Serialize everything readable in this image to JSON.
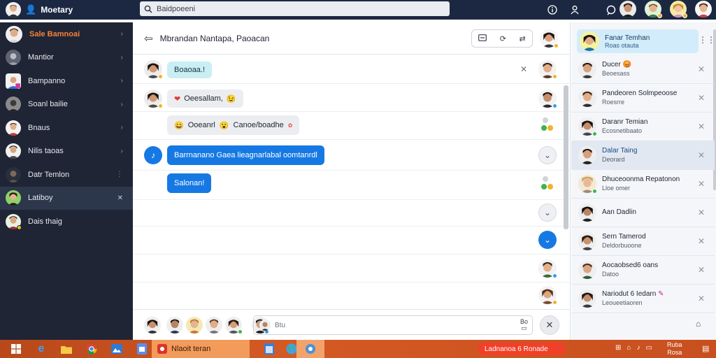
{
  "app": {
    "title": "Moetary"
  },
  "search": {
    "placeholder": "Baidpoeeni"
  },
  "sidebar": {
    "items": [
      {
        "label": "Sale Bamnoai",
        "icon": "chevron-right-icon"
      },
      {
        "label": "Mantior",
        "icon": "chevron-right-icon"
      },
      {
        "label": "Bampanno",
        "icon": "chevron-right-icon"
      },
      {
        "label": "Soanl bailie",
        "icon": "chevron-right-icon"
      },
      {
        "label": "Bnaus",
        "icon": "chevron-right-icon"
      },
      {
        "label": "Nilis taoas",
        "icon": "chevron-right-icon"
      },
      {
        "label": "Datr Temlon",
        "icon": "more-vertical-icon"
      },
      {
        "label": "Latiboy",
        "icon": "close-icon"
      },
      {
        "label": "Dais thaig",
        "icon": ""
      }
    ]
  },
  "chat": {
    "title": "Mbrandan Nantapa, Paoacan",
    "header_tools": [
      "window-icon",
      "refresh-icon",
      "share-icon"
    ],
    "messages": [
      {
        "text": "Boaoaa.!",
        "style": "cyan"
      },
      {
        "text": "Oeesallam,",
        "emoji_before": "❤",
        "emoji_after": "😉",
        "style": "gray"
      },
      {
        "text": "Ooeanrl",
        "emoji_before": "😄",
        "extra": "Canoe/boadhe",
        "style": "gray"
      },
      {
        "text": "Barrnanano Gaea lieagnarlabal oomtanrdl",
        "style": "blue"
      },
      {
        "text": "Salonan!",
        "style": "blue"
      }
    ],
    "composer_placeholder": "Btu",
    "composer_hint": "Bo"
  },
  "right_panel": {
    "header": {
      "name": "Fanar Temhan",
      "sub": "Roas otauta"
    },
    "contacts": [
      {
        "name": "Ducer",
        "status": "Beoesass"
      },
      {
        "name": "Pandeoren Solmpeoose",
        "status": "Roesrre"
      },
      {
        "name": "Daranr Temian",
        "status": "Ecosnetibaato"
      },
      {
        "name": "Dalar Taing",
        "status": "Deorard"
      },
      {
        "name": "Dhuceoonma Repatonon",
        "status": "Lloe omer"
      },
      {
        "name": "Aan Dadlin",
        "status": ""
      },
      {
        "name": "Sern Tamerod",
        "status": "Deldorbuoone"
      },
      {
        "name": "Aocaobsed6 oans",
        "status": "Datoo"
      },
      {
        "name": "Nariodut 6 Iedarn",
        "status": "Leoueetiaoren"
      }
    ]
  },
  "taskbar": {
    "active_task": "Nlaoit teran",
    "notice": "Ladnanoa 6 Ronade",
    "clock_time": "Ruba",
    "clock_date": "Rosa"
  },
  "colors": {
    "topbar": "#1c2842",
    "sidebar": "#1f2535",
    "accent_blue": "#1679e3",
    "accent_orange": "#f3823a",
    "taskbar": "#c8501f"
  }
}
